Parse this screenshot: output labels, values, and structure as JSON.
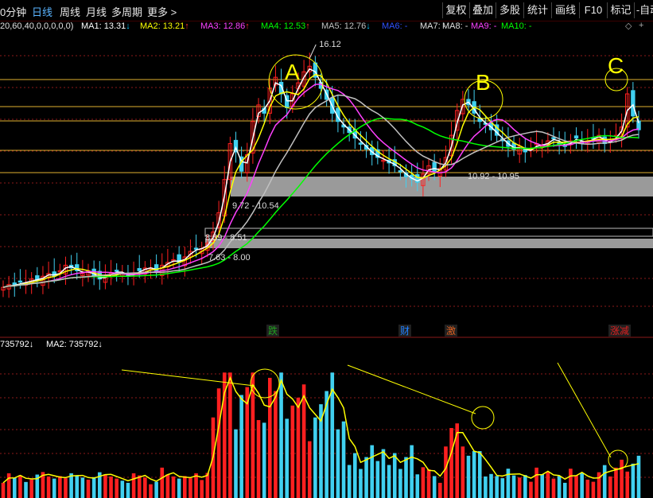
{
  "toolbar": {
    "tabs": [
      "0分钟",
      "日线",
      "周线",
      "月线",
      "多周期",
      "更多 >"
    ],
    "buttons": [
      "复权",
      "叠加",
      "多股",
      "统计",
      "画线",
      "F10",
      "标记",
      "-自动"
    ]
  },
  "ma_bar": {
    "params": "20,60,40,0,0,0,0,0)",
    "items": [
      {
        "label": "MA1: 13.31",
        "arrow": "↓",
        "color": "#ffffff",
        "arrow_color": "#00c8ff"
      },
      {
        "label": "MA2: 13.21",
        "arrow": "↑",
        "color": "#ffff00",
        "arrow_color": "#ff3030"
      },
      {
        "label": "MA3: 12.86",
        "arrow": "↑",
        "color": "#ff40ff",
        "arrow_color": "#ff3030"
      },
      {
        "label": "MA4: 12.53",
        "arrow": "↑",
        "color": "#00ff00",
        "arrow_color": "#ff3030"
      },
      {
        "label": "MA5: 12.76",
        "arrow": "↓",
        "color": "#c0c0c0",
        "arrow_color": "#00c8ff"
      },
      {
        "label": "MA6: -",
        "arrow": "",
        "color": "#3050ff",
        "arrow_color": ""
      },
      {
        "label": "MA7: -",
        "arrow": "",
        "color": "#e0e0e0",
        "arrow_color": ""
      },
      {
        "label": "MA8: -",
        "arrow": "",
        "color": "#e0e0e0",
        "arrow_color": ""
      },
      {
        "label": "MA9: -",
        "arrow": "",
        "color": "#ff40ff",
        "arrow_color": ""
      },
      {
        "label": "MA10: -",
        "arrow": "",
        "color": "#00ff00",
        "arrow_color": ""
      }
    ]
  },
  "volume_bar": {
    "items": [
      {
        "label": "735792",
        "arrow": "↓",
        "color": "#ffffff"
      },
      {
        "label": "MA2: 735792",
        "arrow": "↓",
        "color": "#ffffff"
      }
    ]
  },
  "colors": {
    "up": "#ff2020",
    "down": "#40d0f0",
    "ma1": "#ffffff",
    "ma2": "#ffff00",
    "ma3": "#ff40ff",
    "ma4": "#00ff00",
    "ma5": "#c0c0c0",
    "grid": "#8b1a1a",
    "hline": "#e0b030",
    "zone": "#9a9a9a",
    "annotation": "#ffff00"
  },
  "chart_data": {
    "type": "candlestick",
    "price_max_label": "16.12",
    "price_zones": [
      {
        "label": "10.92 - 10.95"
      },
      {
        "label": "9.72 - 10.54"
      },
      {
        "label": "8.39 - 8.51"
      },
      {
        "label": "7.63 - 8.00"
      }
    ],
    "annotations": [
      "A",
      "B",
      "C"
    ],
    "event_markers": [
      {
        "label": "跌",
        "color": "#20a020"
      },
      {
        "label": "财",
        "color": "#2080ff"
      },
      {
        "label": "激",
        "color": "#e06020"
      },
      {
        "label": "涨减",
        "color": "#e02020"
      }
    ],
    "price_series": [
      7.6,
      7.7,
      7.65,
      7.8,
      7.75,
      7.9,
      7.85,
      8.0,
      8.1,
      8.0,
      8.2,
      8.4,
      8.3,
      8.2,
      8.1,
      8.2,
      8.0,
      7.9,
      8.0,
      8.1,
      8.2,
      8.1,
      8.0,
      8.1,
      8.2,
      8.3,
      8.3,
      8.2,
      8.4,
      8.5,
      8.6,
      8.5,
      8.7,
      8.9,
      9.0,
      9.0,
      9.2,
      9.6,
      10.3,
      11.5,
      12.8,
      12.5,
      11.8,
      12.4,
      13.6,
      14.2,
      13.9,
      14.8,
      15.2,
      14.6,
      14.1,
      14.6,
      15.0,
      15.4,
      15.6,
      15.2,
      14.8,
      14.4,
      13.9,
      13.6,
      13.4,
      13.2,
      13.0,
      12.8,
      12.6,
      12.4,
      12.3,
      12.2,
      12.1,
      12.0,
      11.8,
      11.6,
      11.5,
      11.4,
      11.7,
      12.0,
      11.8,
      11.9,
      12.3,
      13.1,
      14.0,
      14.4,
      14.2,
      13.9,
      13.6,
      13.5,
      13.3,
      13.1,
      12.9,
      12.7,
      12.6,
      12.7,
      12.5,
      12.6,
      12.8,
      12.7,
      12.9,
      13.0,
      12.8,
      12.7,
      12.9,
      13.0,
      12.8,
      12.9,
      13.0,
      13.1,
      12.8,
      12.9,
      13.1,
      13.4,
      14.6,
      13.8,
      13.3
    ]
  }
}
